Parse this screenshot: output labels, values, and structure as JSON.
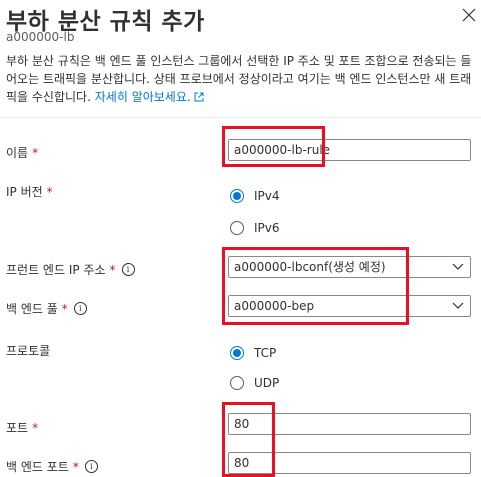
{
  "header": {
    "title": "부하 분산 규칙 추가",
    "subtitle": "a000000-lb",
    "close_icon": "close-icon"
  },
  "description": {
    "text": "부하 분산 규칙은 백 엔드 풀 인스턴스 그룹에서 선택한 IP 주소 및 포트 조합으로 전송되는 들어오는 트래픽을 분산합니다. 상태 프로브에서 정상이라고 여기는 백 엔드 인스턴스만 새 트래픽을 수신합니다.",
    "link": "자세히 알아보세요."
  },
  "form": {
    "name": {
      "label": "이름",
      "required": "*",
      "value": "a000000-lb-rule"
    },
    "ip_version": {
      "label": "IP 버전",
      "required": "*",
      "options": [
        {
          "label": "IPv4",
          "selected": true
        },
        {
          "label": "IPv6",
          "selected": false
        }
      ]
    },
    "frontend_ip": {
      "label": "프런트 엔드 IP 주소",
      "required": "*",
      "value": "a000000-lbconf(생성 예정)"
    },
    "backend_pool": {
      "label": "백 엔드 풀",
      "required": "*",
      "value": "a000000-bep"
    },
    "protocol": {
      "label": "프로토콜",
      "options": [
        {
          "label": "TCP",
          "selected": true
        },
        {
          "label": "UDP",
          "selected": false
        }
      ]
    },
    "port": {
      "label": "포트",
      "required": "*",
      "value": "80"
    },
    "backend_port": {
      "label": "백 엔드 포트",
      "required": "*",
      "value": "80"
    }
  },
  "colors": {
    "accent": "#0078d4",
    "required": "#a4262c",
    "highlight": "#e81123"
  }
}
